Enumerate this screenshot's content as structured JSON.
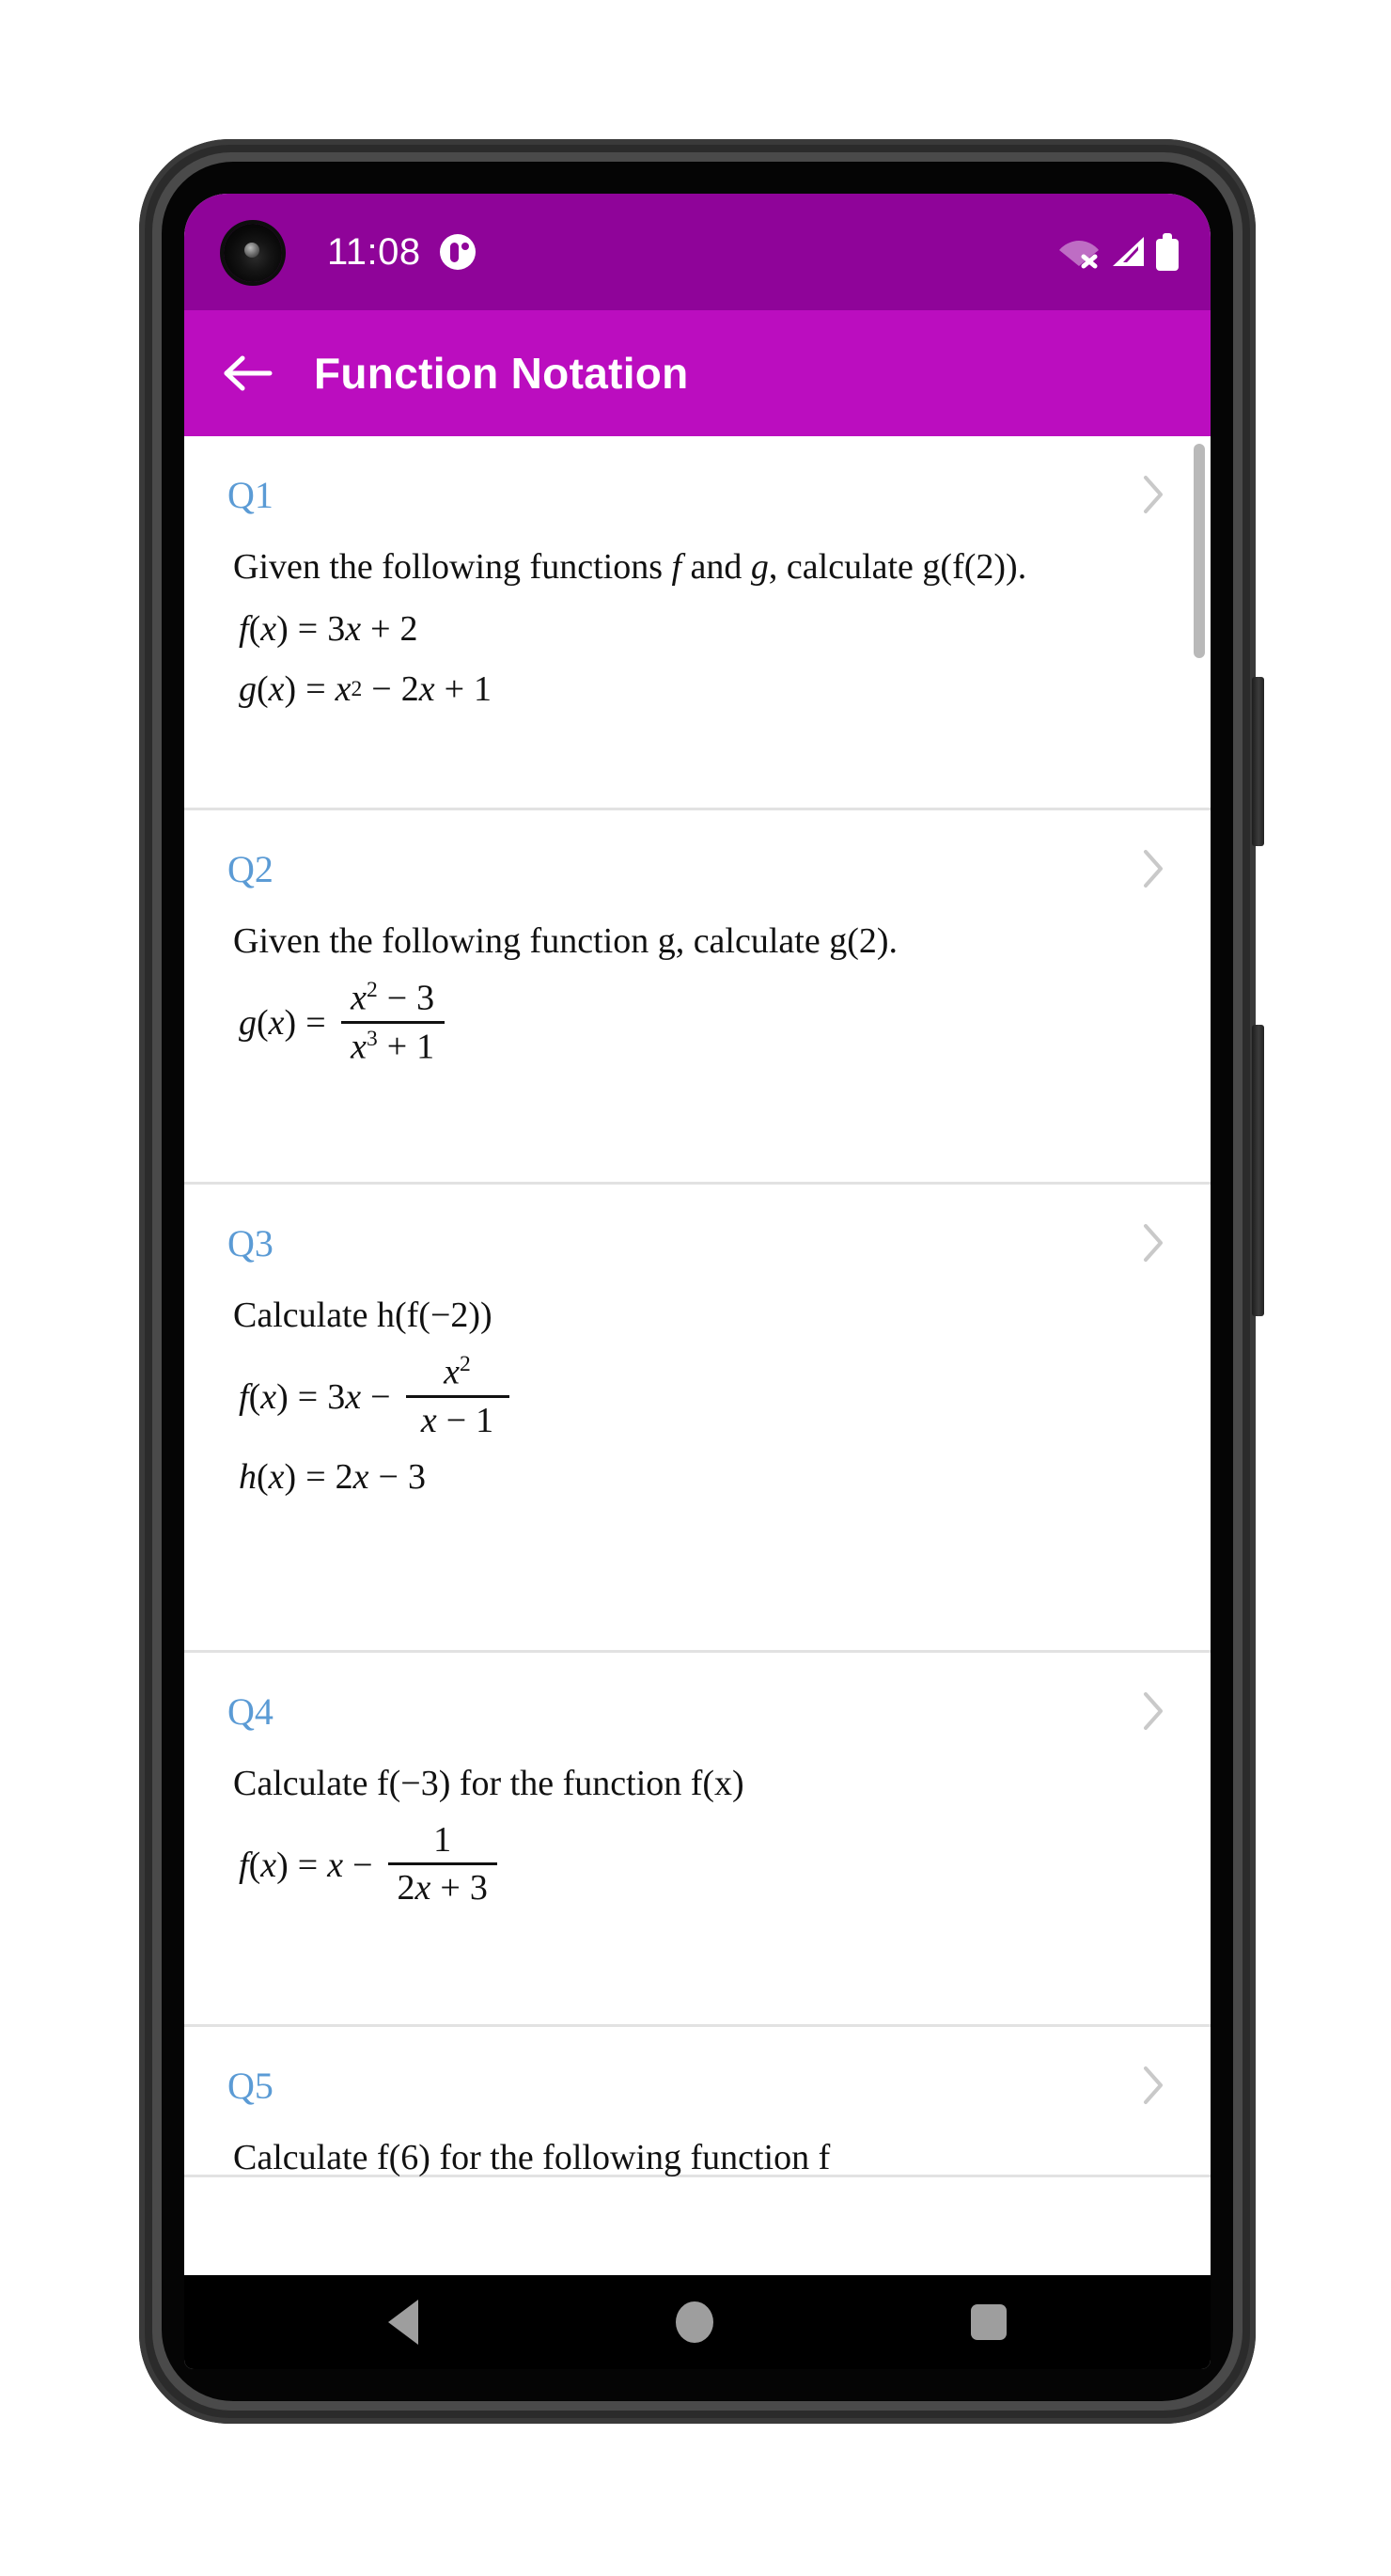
{
  "status_bar": {
    "time": "11:08",
    "background_color": "#8f0499",
    "icons": {
      "notification": "notification-dot-icon",
      "wifi": "wifi-off-icon",
      "signal": "signal-bars-icon",
      "battery": "battery-full-icon"
    }
  },
  "app_bar": {
    "title": "Function Notation",
    "back_icon": "back-arrow-icon",
    "background_color": "#bb0dbf",
    "text_color": "#ffffff"
  },
  "theme": {
    "question_label_color": "#5b9bd5",
    "divider_color": "#e2e2e2",
    "chevron_color": "#c9c9c9"
  },
  "questions": [
    {
      "label": "Q1",
      "prompt_parts": [
        {
          "t": "Given the following functions ",
          "style": "normal"
        },
        {
          "t": "f",
          "style": "italic"
        },
        {
          "t": " and ",
          "style": "normal"
        },
        {
          "t": "g",
          "style": "italic"
        },
        {
          "t": ", calculate g(f(2)).",
          "style": "normal"
        }
      ],
      "prompt_text": "Given the following functions f and g, calculate g(f(2)).",
      "equations": [
        "f(x) = 3x + 2",
        "g(x) = x² − 2x + 1"
      ],
      "chevron": "chevron-right-icon"
    },
    {
      "label": "Q2",
      "prompt_text": "Given the following function g, calculate g(2).",
      "equations": [
        "g(x) = (x² − 3) / (x³ + 1)"
      ],
      "chevron": "chevron-right-icon"
    },
    {
      "label": "Q3",
      "prompt_text": "Calculate h(f(−2))",
      "equations": [
        "f(x) = 3x − x²/(x − 1)",
        "h(x) = 2x − 3"
      ],
      "chevron": "chevron-right-icon"
    },
    {
      "label": "Q4",
      "prompt_text": "Calculate f(−3) for the function f(x)",
      "equations": [
        "f(x) = x − 1/(2x + 3)"
      ],
      "chevron": "chevron-right-icon"
    },
    {
      "label": "Q5",
      "prompt_text": "Calculate f(6) for the following function f",
      "equations": [],
      "chevron": "chevron-right-icon"
    }
  ],
  "nav_bar": {
    "back": "nav-back-icon",
    "home": "nav-home-icon",
    "recents": "nav-recents-icon"
  },
  "math": {
    "q1_f": {
      "lhs_f": "f",
      "lhs_open": "(",
      "lhs_var": "x",
      "lhs_close": ")",
      "eq": "=",
      "c3": "3",
      "vx": "x",
      "plus": "+",
      "c2": "2"
    },
    "q1_g": {
      "lhs_g": "g",
      "ex2": "2",
      "minus": "−",
      "c2b": "2",
      "plus": "+",
      "one": "1"
    },
    "q2_g": {
      "num_var": "x",
      "num_ex": "2",
      "num_op": "−",
      "num_c": "3",
      "den_var": "x",
      "den_ex": "3",
      "den_op": "+",
      "den_c": "1"
    },
    "q3_f": {
      "c3": "3",
      "minus": "−",
      "num_var": "x",
      "num_ex": "2",
      "den_var": "x",
      "den_op": "−",
      "den_c": "1"
    },
    "q3_h": {
      "h": "h",
      "c2": "2",
      "minus": "−",
      "c3": "3"
    },
    "q4_f": {
      "var": "x",
      "minus": "−",
      "num": "1",
      "den_c2": "2",
      "den_var": "x",
      "den_op": "+",
      "den_c3": "3"
    }
  }
}
